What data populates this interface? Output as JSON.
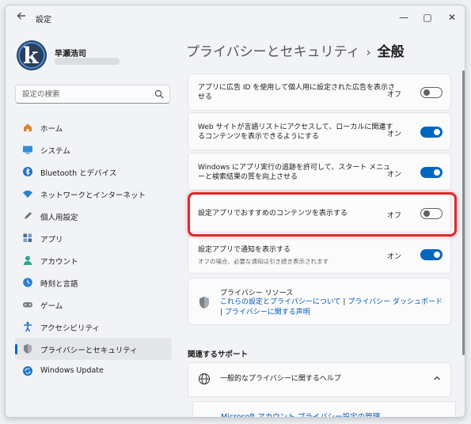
{
  "window": {
    "app_title": "設定",
    "back_icon": "arrow-left-icon",
    "controls": {
      "minimize": "—",
      "maximize": "▢",
      "close": "✕"
    }
  },
  "profile": {
    "name": "早瀬浩司"
  },
  "search": {
    "placeholder": "設定の検索"
  },
  "sidebar": {
    "items": [
      {
        "label": "ホーム",
        "icon": "home-icon",
        "color": "#d9822b"
      },
      {
        "label": "システム",
        "icon": "monitor-icon",
        "color": "#2f8fd8"
      },
      {
        "label": "Bluetooth とデバイス",
        "icon": "bluetooth-icon",
        "color": "#1f74c8"
      },
      {
        "label": "ネットワークとインターネット",
        "icon": "wifi-icon",
        "color": "#2b7fd0"
      },
      {
        "label": "個人用設定",
        "icon": "pencil-icon",
        "color": "#6b6e73"
      },
      {
        "label": "アプリ",
        "icon": "apps-grid-icon",
        "color": "#4b6b8f"
      },
      {
        "label": "アカウント",
        "icon": "person-icon",
        "color": "#2fa88c"
      },
      {
        "label": "時刻と言語",
        "icon": "clock-globe-icon",
        "color": "#2b7fd0"
      },
      {
        "label": "ゲーム",
        "icon": "gamepad-icon",
        "color": "#7d7f83"
      },
      {
        "label": "アクセシビリティ",
        "icon": "accessibility-icon",
        "color": "#1f6fc2"
      },
      {
        "label": "プライバシーとセキュリティ",
        "icon": "shield-icon",
        "color": "#7d8189",
        "active": true
      },
      {
        "label": "Windows Update",
        "icon": "update-icon",
        "color": "#1f74c8"
      }
    ]
  },
  "breadcrumb": {
    "parent": "プライバシーとセキュリティ",
    "separator": "›",
    "current": "全般"
  },
  "settings": [
    {
      "label": "アプリに広告 ID を使用して個人用に設定された広告を表示させる",
      "state": "オフ",
      "on": false
    },
    {
      "label": "Web サイトが言語リストにアクセスして、ローカルに関連するコンテンツを表示できるようにする",
      "state": "オン",
      "on": true
    },
    {
      "label": "Windows にアプリ実行の追跡を許可して、スタート メニューと検索結果の質を向上させる",
      "state": "オン",
      "on": true
    },
    {
      "label": "設定アプリでおすすめのコンテンツを表示する",
      "state": "オフ",
      "on": false
    },
    {
      "label": "設定アプリで通知を表示する",
      "description": "オフの場合、必要な通知は引き続き表示されます",
      "state": "オン",
      "on": true
    }
  ],
  "privacy_resources": {
    "title": "プライバシー リソース",
    "link1": "これらの設定とプライバシーについて",
    "sep": " | ",
    "link2": "プライバシー ダッシュボード",
    "link3": "プライバシーに関する声明"
  },
  "related_support": {
    "heading": "関連するサポート",
    "help_label": "一般的なプライバシーに関するヘルプ",
    "help_link": "Microsoft アカウント プライバシー設定の管理"
  },
  "colors": {
    "accent": "#0067c0",
    "highlight": "#e3262a",
    "link": "#0059b3"
  }
}
